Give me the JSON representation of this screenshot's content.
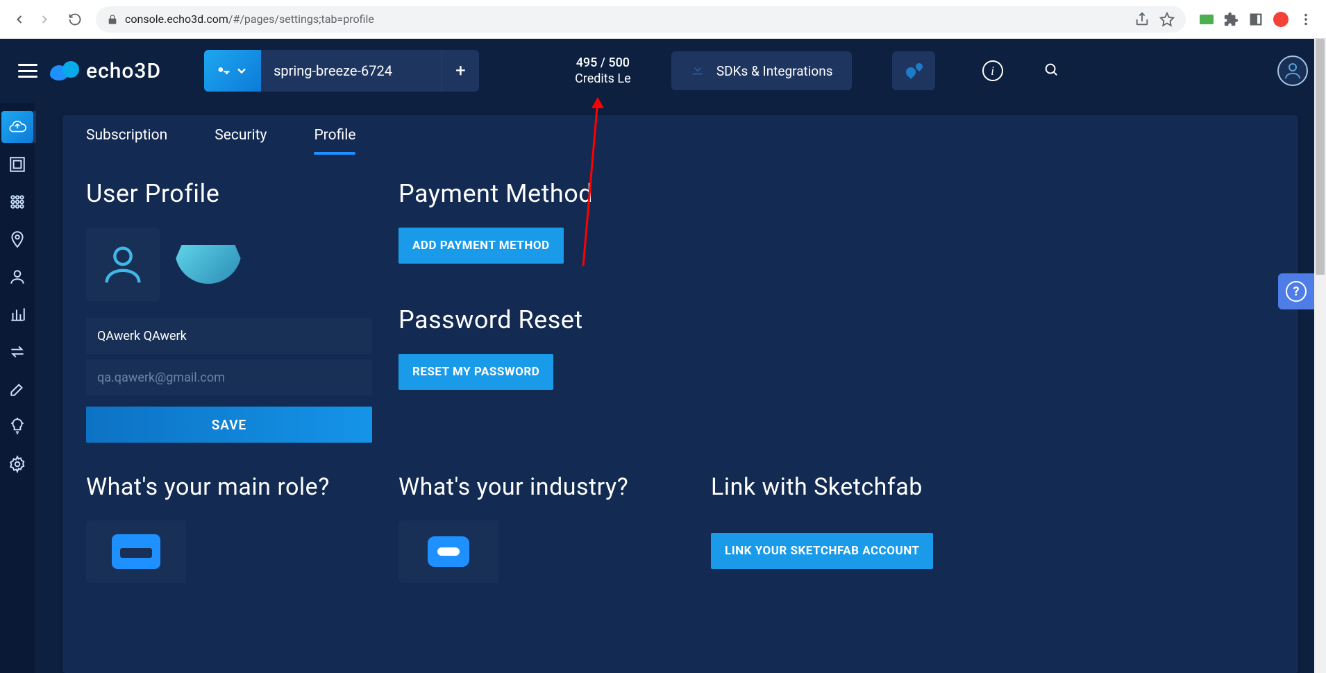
{
  "browser": {
    "url_domain": "console.echo3d.com",
    "url_path": "/#/pages/settings;tab=profile"
  },
  "header": {
    "logo_text": "echo3D",
    "project_name": "spring-breeze-6724",
    "credits_line1": "495 / 500",
    "credits_line2": "Credits Le",
    "sdk_label": "SDKs & Integrations"
  },
  "tabs": {
    "subscription": "Subscription",
    "security": "Security",
    "profile": "Profile"
  },
  "profile": {
    "title": "User Profile",
    "name_value": "QAwerk QAwerk",
    "email_value": "qa.qawerk@gmail.com",
    "save_label": "SAVE"
  },
  "payment": {
    "title": "Payment Method",
    "add_btn": "ADD PAYMENT METHOD"
  },
  "password": {
    "title": "Password Reset",
    "reset_btn": "RESET MY PASSWORD"
  },
  "role": {
    "title": "What's your main role?"
  },
  "industry": {
    "title": "What's your industry?"
  },
  "sketchfab": {
    "title": "Link with Sketchfab",
    "link_btn": "LINK YOUR SKETCHFAB ACCOUNT"
  }
}
